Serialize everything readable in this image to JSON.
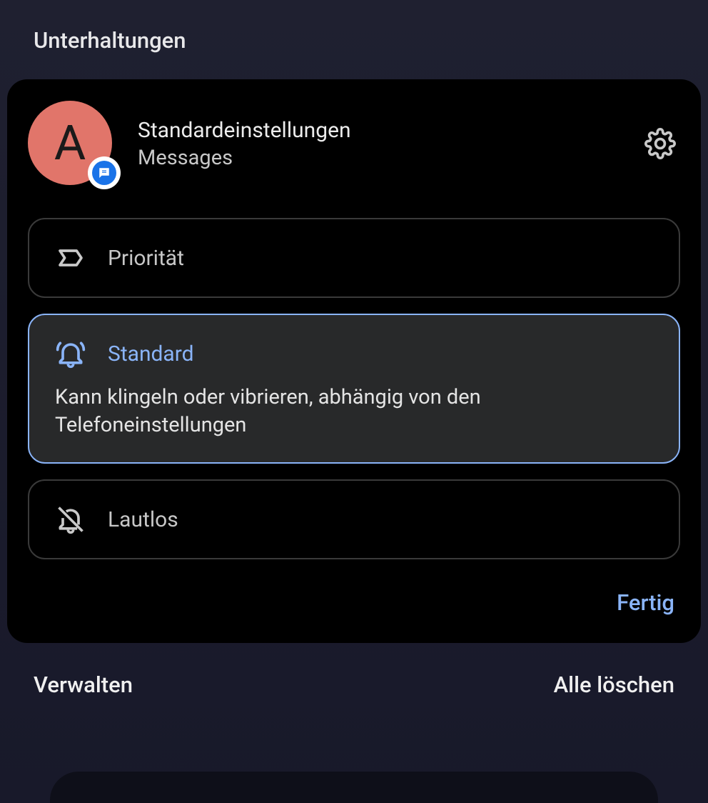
{
  "section_title": "Unterhaltungen",
  "header": {
    "avatar_letter": "A",
    "title": "Standardeinstellungen",
    "subtitle": "Messages"
  },
  "options": {
    "priority": {
      "label": "Priorität"
    },
    "standard": {
      "label": "Standard",
      "description": "Kann klingeln oder vibrieren, abhängig von den Telefoneinstellungen"
    },
    "silent": {
      "label": "Lautlos"
    }
  },
  "done_label": "Fertig",
  "bottom": {
    "manage": "Verwalten",
    "clear_all": "Alle löschen"
  }
}
